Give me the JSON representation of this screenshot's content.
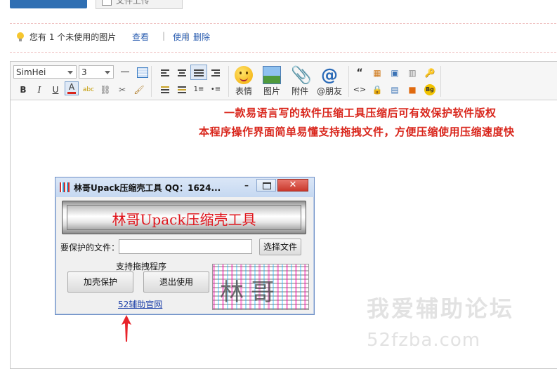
{
  "tabs": {
    "tab2_label": "文件上传"
  },
  "notice": {
    "message": "您有 1 个未使用的图片",
    "actions": [
      "查看",
      "使用",
      "删除"
    ]
  },
  "toolbar": {
    "font_family": "SimHei",
    "font_size": "3",
    "buttons": {
      "emoji": "表情",
      "image": "图片",
      "attachment": "附件",
      "mention": "@朋友"
    }
  },
  "content": {
    "line1": "一款易语言写的软件压缩工具压缩后可有效保护软件版权",
    "line2": "本程序操作界面简单易懂支持拖拽文件，方便压缩使用压缩速度快"
  },
  "app_window": {
    "title": "林哥Upack压缩壳工具  QQ：1624...",
    "minimize_label": "–",
    "close_label": "✕",
    "banner": "林哥Upack压缩壳工具",
    "file_label": "要保护的文件：",
    "file_value": "",
    "choose_button": "选择文件",
    "drag_hint": "支持拖拽程序",
    "protect_button": "加壳保护",
    "exit_button": "退出使用",
    "link": "52辅助官网",
    "logo_text": "林哥"
  },
  "watermark": {
    "name": "我爱辅助论坛",
    "url": "52fzba.com"
  },
  "colors": {
    "red_text": "#d9261c",
    "link": "#2a5db0",
    "accent": "#2f6fb3"
  }
}
